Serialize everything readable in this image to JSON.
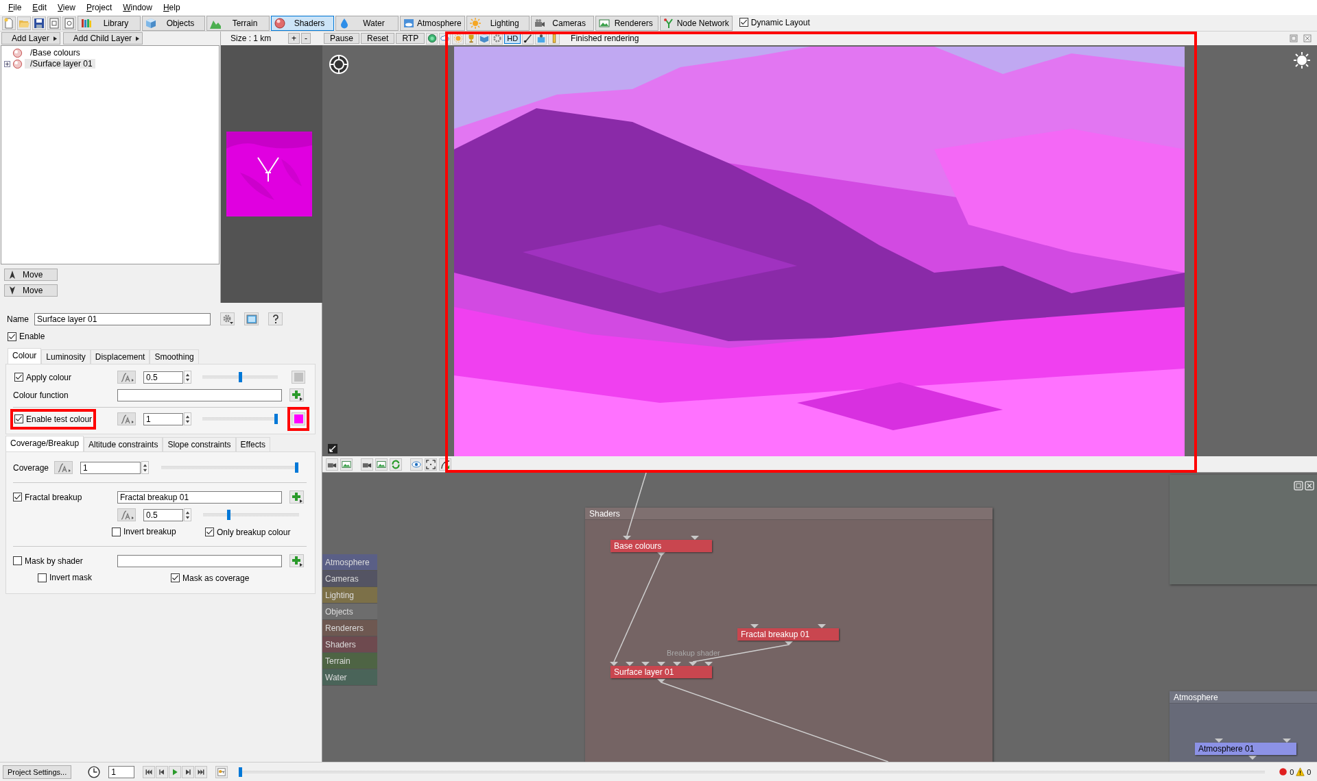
{
  "menu": [
    "File",
    "Edit",
    "View",
    "Project",
    "Window",
    "Help"
  ],
  "toolbar": {
    "buttons": [
      {
        "label": "Library",
        "selected": false
      },
      {
        "label": "Objects",
        "selected": false
      },
      {
        "label": "Terrain",
        "selected": false
      },
      {
        "label": "Shaders",
        "selected": true
      },
      {
        "label": "Water",
        "selected": false
      },
      {
        "label": "Atmosphere",
        "selected": false
      },
      {
        "label": "Lighting",
        "selected": false
      },
      {
        "label": "Cameras",
        "selected": false
      },
      {
        "label": "Renderers",
        "selected": false
      },
      {
        "label": "Node Network",
        "selected": false
      }
    ],
    "dynamic_layout": {
      "label": "Dynamic Layout",
      "checked": true
    }
  },
  "layers": {
    "buttons": [
      "Add Layer",
      "Add Child Layer"
    ],
    "items": [
      {
        "name": "/Base colours",
        "expandable": false,
        "selected": false
      },
      {
        "name": "/Surface layer 01",
        "expandable": true,
        "selected": true
      }
    ],
    "move_buttons": [
      "Move",
      "Move"
    ]
  },
  "preview": {
    "size": "Size : 1 km",
    "zoom_buttons": [
      "+",
      "-"
    ]
  },
  "viewport": {
    "buttons": [
      "Pause",
      "Reset",
      "RTP"
    ],
    "quality": "HD",
    "status": "Finished rendering",
    "highlighted": true
  },
  "properties": {
    "name_label": "Name",
    "name": "Surface layer 01",
    "enable": {
      "label": "Enable",
      "checked": true
    },
    "tabs": [
      {
        "label": "Colour",
        "selected": true
      },
      {
        "label": "Luminosity",
        "selected": false
      },
      {
        "label": "Displacement",
        "selected": false
      },
      {
        "label": "Smoothing",
        "selected": false
      }
    ],
    "colour_rows": [
      {
        "kind": "param",
        "label": "Apply colour",
        "checked": true,
        "value": "0.5",
        "level": 0.5,
        "color": "#c0c0c0",
        "highlighted": false,
        "swatch_highlighted": false
      },
      {
        "kind": "function",
        "label": "Colour function"
      },
      {
        "kind": "param",
        "label": "Enable test colour",
        "checked": true,
        "value": "1",
        "level": 1,
        "color": "#ff00ff",
        "highlighted": true,
        "swatch_highlighted": true
      }
    ],
    "tabs2": [
      {
        "label": "Coverage/Breakup",
        "selected": true
      },
      {
        "label": "Altitude constraints",
        "selected": false
      },
      {
        "label": "Slope constraints",
        "selected": false
      },
      {
        "label": "Effects",
        "selected": false
      }
    ],
    "coverage": {
      "label": "Coverage",
      "value": "1",
      "level": 1
    },
    "fractal": {
      "label": "Fractal breakup",
      "checked": true,
      "shader": "Fractal breakup 01",
      "value": "0.5",
      "level": 0.26,
      "options": [
        {
          "label": "Invert breakup",
          "checked": false
        },
        {
          "label": "Only breakup colour",
          "checked": true
        }
      ]
    },
    "mask": {
      "label": "Mask by shader",
      "checked": false,
      "options": [
        {
          "label": "Invert mask",
          "checked": false
        },
        {
          "label": "Mask as coverage",
          "checked": true
        }
      ]
    }
  },
  "node_network": {
    "categories": [
      {
        "label": "Atmosphere",
        "color": "#5a5f86"
      },
      {
        "label": "Cameras",
        "color": "#545463"
      },
      {
        "label": "Lighting",
        "color": "#7c7048"
      },
      {
        "label": "Objects",
        "color": "#6d6d6d"
      },
      {
        "label": "Renderers",
        "color": "#6e5851"
      },
      {
        "label": "Shaders",
        "color": "#6e4a4f"
      },
      {
        "label": "Terrain",
        "color": "#4e6444"
      },
      {
        "label": "Water",
        "color": "#4a6459"
      }
    ],
    "groups": [
      {
        "title": "Shaders",
        "color": "#756464",
        "nodes": [
          {
            "label": "Base colours",
            "color": "#c9464f"
          },
          {
            "label": "Fractal breakup 01",
            "color": "#c9464f"
          },
          {
            "label": "Surface layer 01",
            "color": "#c9464f",
            "input_label": "Breakup shader"
          }
        ]
      },
      {
        "title": "Atmosphere",
        "color": "#676a78",
        "nodes": [
          {
            "label": "Atmosphere 01",
            "color": "#8c92e6"
          }
        ]
      }
    ]
  },
  "status_bar": {
    "project_settings": "Project Settings...",
    "frame": "1",
    "errors": "0",
    "warnings": "0",
    "level": 0
  }
}
